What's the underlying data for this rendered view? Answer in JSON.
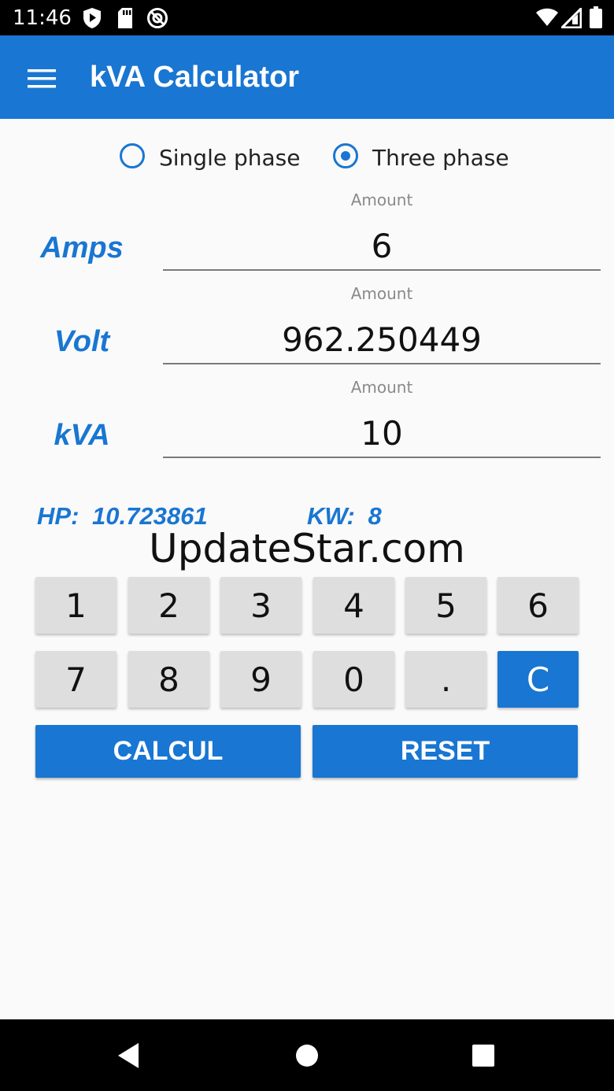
{
  "status_bar": {
    "time": "11:46",
    "left_icons": [
      "shield-play-icon",
      "sd-card-icon",
      "no-sync-icon"
    ],
    "right_icons": [
      "wifi-icon",
      "signal-icon",
      "battery-icon"
    ]
  },
  "app_bar": {
    "title": "kVA Calculator",
    "menu_icon": "hamburger-menu-icon",
    "color": "#1976d2"
  },
  "phase_options": [
    {
      "label": "Single phase",
      "selected": false
    },
    {
      "label": "Three phase",
      "selected": true
    }
  ],
  "fields": [
    {
      "label": "Amps",
      "hint": "Amount",
      "value": "6"
    },
    {
      "label": "Volt",
      "hint": "Amount",
      "value": "962.250449"
    },
    {
      "label": "kVA",
      "hint": "Amount",
      "value": "10"
    }
  ],
  "results": {
    "hp_label": "HP:",
    "hp_value": "10.723861",
    "kw_label": "KW:",
    "kw_value": "8"
  },
  "watermark": "UpdateStar.com",
  "keypad": {
    "row1": [
      "1",
      "2",
      "3",
      "4",
      "5",
      "6"
    ],
    "row2": [
      "7",
      "8",
      "9",
      "0",
      ".",
      "C"
    ]
  },
  "buttons": {
    "calcul": "CALCUL",
    "reset": "RESET"
  },
  "nav_bar": {
    "icons": [
      "back-icon",
      "home-icon",
      "recents-icon"
    ]
  }
}
